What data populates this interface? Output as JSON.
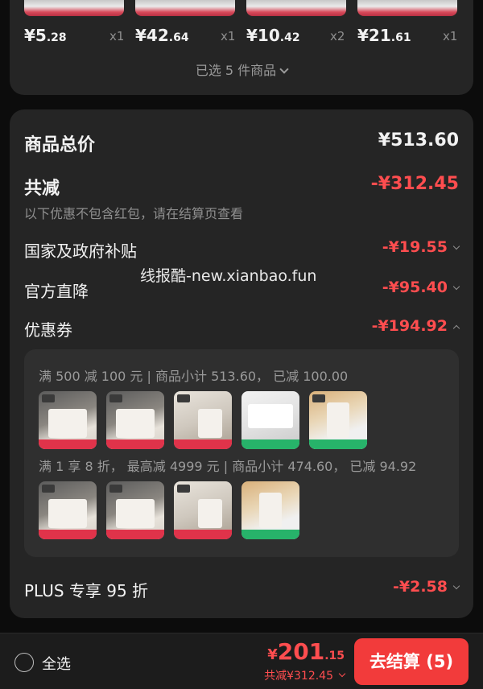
{
  "products": [
    {
      "yen": "¥",
      "int": "5",
      "dec": ".28",
      "qty": "x1"
    },
    {
      "yen": "¥",
      "int": "42",
      "dec": ".64",
      "qty": "x1"
    },
    {
      "yen": "¥",
      "int": "10",
      "dec": ".42",
      "qty": "x2"
    },
    {
      "yen": "¥",
      "int": "21",
      "dec": ".61",
      "qty": "x1"
    }
  ],
  "selected_label": "已选 5 件商品",
  "summary": {
    "total_label": "商品总价",
    "total_value": "¥513.60",
    "discount_label": "共减",
    "discount_value": "-¥312.45",
    "note": "以下优惠不包含红包，请在结算页查看",
    "subsidy_label": "国家及政府补贴",
    "subsidy_value": "-¥19.55",
    "official_label": "官方直降",
    "official_value": "-¥95.40",
    "coupon_label": "优惠券",
    "coupon_value": "-¥194.92",
    "coupon_line1": "满 500 减 100 元 | 商品小计 513.60， 已减 100.00",
    "coupon_line2": "满 1 享 8 折， 最高减 4999 元 | 商品小计 474.60， 已减 94.92",
    "plus_label": "PLUS 专享 95 折",
    "plus_value": "-¥2.58"
  },
  "watermark": "线报酷-new.xianbao.fun",
  "bottom": {
    "select_all": "全选",
    "yen": "¥",
    "total_int": "201",
    "total_dec": ".15",
    "total_sub": "共减¥312.45",
    "checkout": "去结算 (5)"
  },
  "colors": {
    "accent": "#ff4d4f",
    "checkout": "#f23b3b",
    "card": "#252525",
    "background": "#0c0c0c"
  }
}
